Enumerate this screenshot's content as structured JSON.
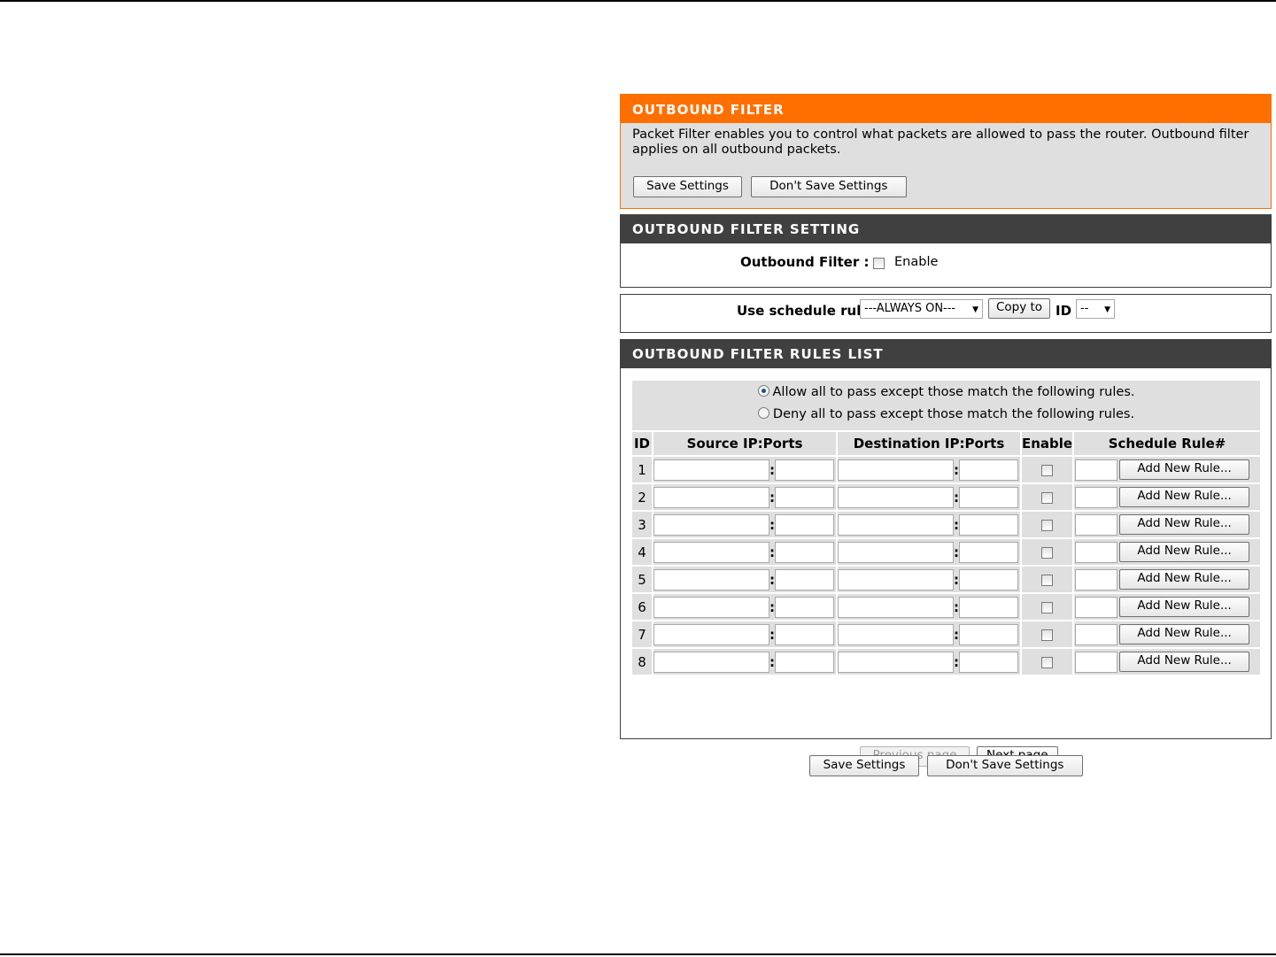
{
  "intro": {
    "title": "OUTBOUND FILTER",
    "description": "Packet Filter enables you to control what packets are allowed to pass the router. Outbound filter applies on all outbound packets.",
    "save_label": "Save Settings",
    "dont_save_label": "Don't Save Settings"
  },
  "setting": {
    "title": "OUTBOUND FILTER SETTING",
    "filter_label": "Outbound Filter :",
    "enable_label": "Enable",
    "enabled": false
  },
  "schedule": {
    "label": "Use schedule rule",
    "selected": "---ALWAYS ON---",
    "copy_label": "Copy to",
    "id_label": "ID",
    "id_selected": "--"
  },
  "rules": {
    "title": "OUTBOUND FILTER RULES LIST",
    "allow_label": "Allow all to pass except those match the following rules.",
    "deny_label": "Deny all to pass except those match the following rules.",
    "mode": "allow",
    "columns": [
      "ID",
      "Source IP:Ports",
      "Destination IP:Ports",
      "Enable",
      "Schedule Rule#"
    ],
    "rows": [
      {
        "id": "1",
        "add_label": "Add New Rule..."
      },
      {
        "id": "2",
        "add_label": "Add New Rule..."
      },
      {
        "id": "3",
        "add_label": "Add New Rule..."
      },
      {
        "id": "4",
        "add_label": "Add New Rule..."
      },
      {
        "id": "5",
        "add_label": "Add New Rule..."
      },
      {
        "id": "6",
        "add_label": "Add New Rule..."
      },
      {
        "id": "7",
        "add_label": "Add New Rule..."
      },
      {
        "id": "8",
        "add_label": "Add New Rule..."
      }
    ],
    "prev_label": "Previous page",
    "next_label": "Next page"
  },
  "footer": {
    "save_label": "Save Settings",
    "dont_save_label": "Don't Save Settings"
  },
  "colors": {
    "accent": "#ff6f00",
    "header_dark": "#404040",
    "panel_bg": "#dfdfdf"
  }
}
